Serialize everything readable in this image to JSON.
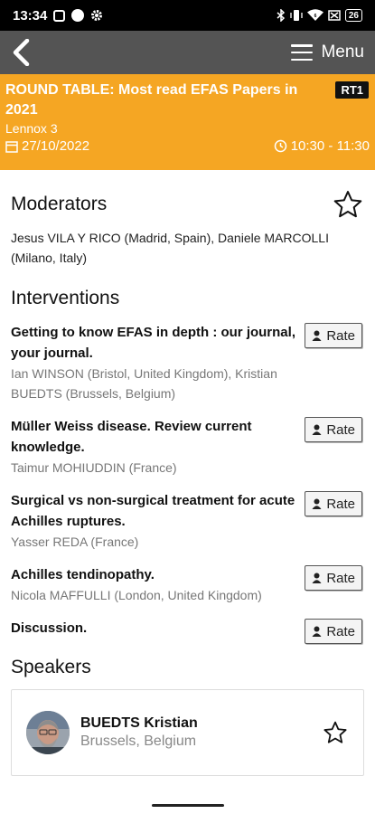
{
  "status_bar": {
    "time": "13:34",
    "battery": "26"
  },
  "nav": {
    "menu_label": "Menu"
  },
  "session": {
    "title": "ROUND TABLE: Most read EFAS Papers in 2021",
    "code": "RT1",
    "room": "Lennox 3",
    "date": "27/10/2022",
    "time": "10:30 - 11:30"
  },
  "moderators": {
    "heading": "Moderators",
    "text": "Jesus VILA Y RICO (Madrid, Spain), Daniele MARCOLLI (Milano, Italy)"
  },
  "interventions": {
    "heading": "Interventions",
    "rate_label": "Rate",
    "items": [
      {
        "title": "Getting to know EFAS in depth : our journal, your journal.",
        "speakers": "Ian WINSON (Bristol, United Kingdom), Kristian BUEDTS (Brussels, Belgium)"
      },
      {
        "title": "Müller Weiss disease. Review current knowledge.",
        "speakers": "Taimur MOHIUDDIN (France)"
      },
      {
        "title": "Surgical vs non-surgical treatment for acute Achilles ruptures.",
        "speakers": "Yasser REDA (France)"
      },
      {
        "title": "Achilles tendinopathy.",
        "speakers": "Nicola MAFFULLI (London, United Kingdom)"
      },
      {
        "title": "Discussion.",
        "speakers": ""
      }
    ]
  },
  "speakers": {
    "heading": "Speakers",
    "items": [
      {
        "name": "BUEDTS Kristian",
        "location": "Brussels, Belgium"
      }
    ]
  },
  "colors": {
    "session_banner": "#f5a623",
    "navbar": "#545454"
  },
  "icons": [
    "back-arrow-icon",
    "hamburger-icon",
    "calendar-icon",
    "clock-icon",
    "star-outline-icon",
    "person-icon"
  ]
}
